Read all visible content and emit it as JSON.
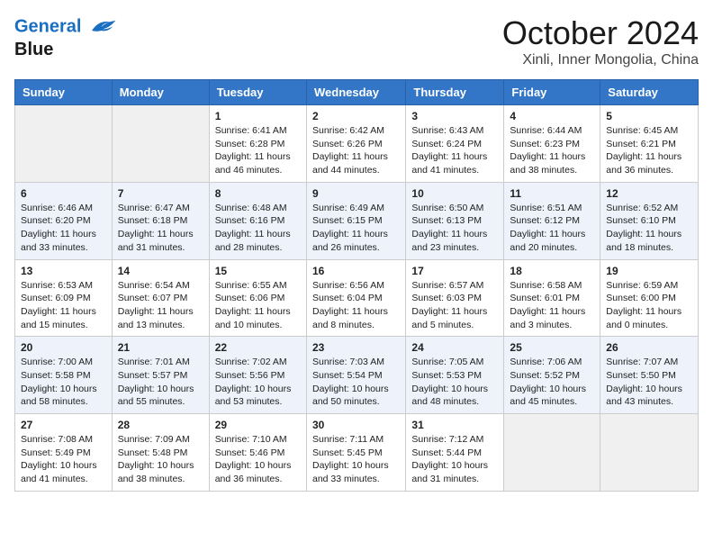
{
  "logo": {
    "line1": "General",
    "line2": "Blue"
  },
  "title": "October 2024",
  "location": "Xinli, Inner Mongolia, China",
  "days_of_week": [
    "Sunday",
    "Monday",
    "Tuesday",
    "Wednesday",
    "Thursday",
    "Friday",
    "Saturday"
  ],
  "weeks": [
    [
      {
        "day": "",
        "info": ""
      },
      {
        "day": "",
        "info": ""
      },
      {
        "day": "1",
        "sunrise": "6:41 AM",
        "sunset": "6:28 PM",
        "daylight": "11 hours and 46 minutes."
      },
      {
        "day": "2",
        "sunrise": "6:42 AM",
        "sunset": "6:26 PM",
        "daylight": "11 hours and 44 minutes."
      },
      {
        "day": "3",
        "sunrise": "6:43 AM",
        "sunset": "6:24 PM",
        "daylight": "11 hours and 41 minutes."
      },
      {
        "day": "4",
        "sunrise": "6:44 AM",
        "sunset": "6:23 PM",
        "daylight": "11 hours and 38 minutes."
      },
      {
        "day": "5",
        "sunrise": "6:45 AM",
        "sunset": "6:21 PM",
        "daylight": "11 hours and 36 minutes."
      }
    ],
    [
      {
        "day": "6",
        "sunrise": "6:46 AM",
        "sunset": "6:20 PM",
        "daylight": "11 hours and 33 minutes."
      },
      {
        "day": "7",
        "sunrise": "6:47 AM",
        "sunset": "6:18 PM",
        "daylight": "11 hours and 31 minutes."
      },
      {
        "day": "8",
        "sunrise": "6:48 AM",
        "sunset": "6:16 PM",
        "daylight": "11 hours and 28 minutes."
      },
      {
        "day": "9",
        "sunrise": "6:49 AM",
        "sunset": "6:15 PM",
        "daylight": "11 hours and 26 minutes."
      },
      {
        "day": "10",
        "sunrise": "6:50 AM",
        "sunset": "6:13 PM",
        "daylight": "11 hours and 23 minutes."
      },
      {
        "day": "11",
        "sunrise": "6:51 AM",
        "sunset": "6:12 PM",
        "daylight": "11 hours and 20 minutes."
      },
      {
        "day": "12",
        "sunrise": "6:52 AM",
        "sunset": "6:10 PM",
        "daylight": "11 hours and 18 minutes."
      }
    ],
    [
      {
        "day": "13",
        "sunrise": "6:53 AM",
        "sunset": "6:09 PM",
        "daylight": "11 hours and 15 minutes."
      },
      {
        "day": "14",
        "sunrise": "6:54 AM",
        "sunset": "6:07 PM",
        "daylight": "11 hours and 13 minutes."
      },
      {
        "day": "15",
        "sunrise": "6:55 AM",
        "sunset": "6:06 PM",
        "daylight": "11 hours and 10 minutes."
      },
      {
        "day": "16",
        "sunrise": "6:56 AM",
        "sunset": "6:04 PM",
        "daylight": "11 hours and 8 minutes."
      },
      {
        "day": "17",
        "sunrise": "6:57 AM",
        "sunset": "6:03 PM",
        "daylight": "11 hours and 5 minutes."
      },
      {
        "day": "18",
        "sunrise": "6:58 AM",
        "sunset": "6:01 PM",
        "daylight": "11 hours and 3 minutes."
      },
      {
        "day": "19",
        "sunrise": "6:59 AM",
        "sunset": "6:00 PM",
        "daylight": "11 hours and 0 minutes."
      }
    ],
    [
      {
        "day": "20",
        "sunrise": "7:00 AM",
        "sunset": "5:58 PM",
        "daylight": "10 hours and 58 minutes."
      },
      {
        "day": "21",
        "sunrise": "7:01 AM",
        "sunset": "5:57 PM",
        "daylight": "10 hours and 55 minutes."
      },
      {
        "day": "22",
        "sunrise": "7:02 AM",
        "sunset": "5:56 PM",
        "daylight": "10 hours and 53 minutes."
      },
      {
        "day": "23",
        "sunrise": "7:03 AM",
        "sunset": "5:54 PM",
        "daylight": "10 hours and 50 minutes."
      },
      {
        "day": "24",
        "sunrise": "7:05 AM",
        "sunset": "5:53 PM",
        "daylight": "10 hours and 48 minutes."
      },
      {
        "day": "25",
        "sunrise": "7:06 AM",
        "sunset": "5:52 PM",
        "daylight": "10 hours and 45 minutes."
      },
      {
        "day": "26",
        "sunrise": "7:07 AM",
        "sunset": "5:50 PM",
        "daylight": "10 hours and 43 minutes."
      }
    ],
    [
      {
        "day": "27",
        "sunrise": "7:08 AM",
        "sunset": "5:49 PM",
        "daylight": "10 hours and 41 minutes."
      },
      {
        "day": "28",
        "sunrise": "7:09 AM",
        "sunset": "5:48 PM",
        "daylight": "10 hours and 38 minutes."
      },
      {
        "day": "29",
        "sunrise": "7:10 AM",
        "sunset": "5:46 PM",
        "daylight": "10 hours and 36 minutes."
      },
      {
        "day": "30",
        "sunrise": "7:11 AM",
        "sunset": "5:45 PM",
        "daylight": "10 hours and 33 minutes."
      },
      {
        "day": "31",
        "sunrise": "7:12 AM",
        "sunset": "5:44 PM",
        "daylight": "10 hours and 31 minutes."
      },
      {
        "day": "",
        "info": ""
      },
      {
        "day": "",
        "info": ""
      }
    ]
  ]
}
